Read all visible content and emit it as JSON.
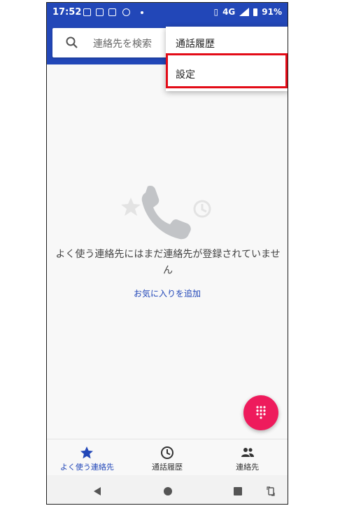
{
  "statusbar": {
    "time": "17:52",
    "network": "4G",
    "battery": "91%"
  },
  "search": {
    "placeholder": "連絡先を検索"
  },
  "menu": {
    "items": [
      "通話履歴",
      "設定"
    ]
  },
  "empty": {
    "message": "よく使う連絡先にはまだ連絡先が登録されていません",
    "add_favorite": "お気に入りを追加"
  },
  "bottom_nav": {
    "items": [
      {
        "label": "よく使う連絡先",
        "icon": "star-icon",
        "active": true
      },
      {
        "label": "通話履歴",
        "icon": "clock-icon",
        "active": false
      },
      {
        "label": "連絡先",
        "icon": "people-icon",
        "active": false
      }
    ]
  },
  "colors": {
    "primary": "#2247b8",
    "fab": "#ee1b5c",
    "highlight": "#e30b17"
  }
}
